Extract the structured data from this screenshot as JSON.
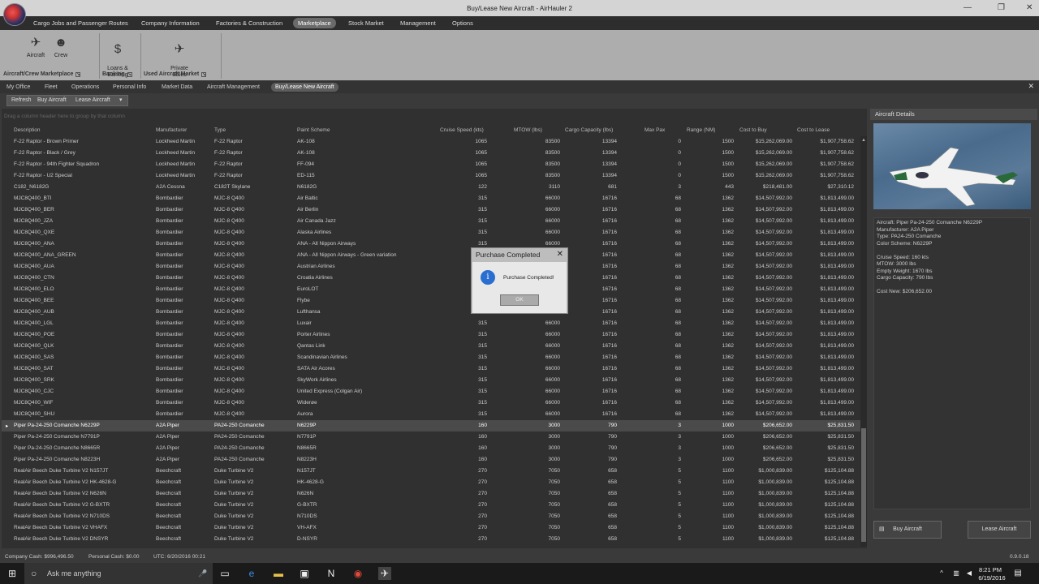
{
  "window": {
    "title": "Buy/Lease New Aircraft - AirHauler 2"
  },
  "menu": {
    "items": [
      "Cargo Jobs and Passenger Routes",
      "Company Information",
      "Factories & Construction",
      "Marketplace",
      "Stock Market",
      "Management",
      "Options"
    ],
    "active": "Marketplace"
  },
  "ribbon": {
    "aircraft": "Aircraft",
    "crew": "Crew",
    "loans": "Loans &\nBanking",
    "private_sales": "Private\nSales",
    "group_aircraft_crew": "Aircraft/Crew Marketplace",
    "group_banking": "Banking",
    "group_used": "Used Aircraft Market"
  },
  "subtabs": {
    "items": [
      "My Office",
      "Fleet",
      "Operations",
      "Personal Info",
      "Market Data",
      "Aircraft Management",
      "Buy/Lease New Aircraft"
    ],
    "active": "Buy/Lease New Aircraft"
  },
  "toolbar": {
    "refresh": "Refresh",
    "buy": "Buy Aircraft",
    "lease": "Lease Aircraft"
  },
  "grid": {
    "group_hint": "Drag a column header here to group by that column",
    "columns": [
      "Description",
      "Manufacturer",
      "Type",
      "Paint Scheme",
      "Cruise Speed (kts)",
      "MTOW (lbs)",
      "Cargo Capacity (lbs)",
      "Max Pax",
      "Range (NM)",
      "Cost to Buy",
      "Cost to Lease"
    ],
    "rows": [
      [
        "F-22 Raptor - Brown Primer",
        "Lockheed Martin",
        "F-22 Raptor",
        "AK-108",
        "1065",
        "83500",
        "13394",
        "0",
        "1500",
        "$15,262,069.00",
        "$1,907,758.62"
      ],
      [
        "F-22 Raptor - Black / Grey",
        "Lockheed Martin",
        "F-22 Raptor",
        "AK-108",
        "1065",
        "83500",
        "13394",
        "0",
        "1500",
        "$15,262,069.00",
        "$1,907,758.62"
      ],
      [
        "F-22 Raptor - 94th Fighter Squadron",
        "Lockheed Martin",
        "F-22 Raptor",
        "FF-094",
        "1065",
        "83500",
        "13394",
        "0",
        "1500",
        "$15,262,069.00",
        "$1,907,758.62"
      ],
      [
        "F-22 Raptor - U2 Special",
        "Lockheed Martin",
        "F-22 Raptor",
        "ED-115",
        "1065",
        "83500",
        "13394",
        "0",
        "1500",
        "$15,262,069.00",
        "$1,907,758.62"
      ],
      [
        "C182_N6182G",
        "A2A Cessna",
        "C182T Skylane",
        "N6182G",
        "122",
        "3110",
        "681",
        "3",
        "443",
        "$218,481.00",
        "$27,310.12"
      ],
      [
        "MJC8Q400_BTI",
        "Bombardier",
        "MJC-8 Q400",
        "Air Baltic",
        "315",
        "66000",
        "16716",
        "68",
        "1362",
        "$14,507,992.00",
        "$1,813,499.00"
      ],
      [
        "MJC8Q400_BER",
        "Bombardier",
        "MJC-8 Q400",
        "Air Berlin",
        "315",
        "66000",
        "16716",
        "68",
        "1362",
        "$14,507,992.00",
        "$1,813,499.00"
      ],
      [
        "MJC8Q400_JZA",
        "Bombardier",
        "MJC-8 Q400",
        "Air Canada Jazz",
        "315",
        "66000",
        "16716",
        "68",
        "1362",
        "$14,507,992.00",
        "$1,813,499.00"
      ],
      [
        "MJC8Q400_QXE",
        "Bombardier",
        "MJC-8 Q400",
        "Alaska Airlines",
        "315",
        "66000",
        "16716",
        "68",
        "1362",
        "$14,507,992.00",
        "$1,813,499.00"
      ],
      [
        "MJC8Q400_ANA",
        "Bombardier",
        "MJC-8 Q400",
        "ANA - All Nippon Airways",
        "315",
        "66000",
        "16716",
        "68",
        "1362",
        "$14,507,992.00",
        "$1,813,499.00"
      ],
      [
        "MJC8Q400_ANA_GREEN",
        "Bombardier",
        "MJC-8 Q400",
        "ANA - All Nippon Airways - Green variation",
        "315",
        "66000",
        "16716",
        "68",
        "1362",
        "$14,507,992.00",
        "$1,813,499.00"
      ],
      [
        "MJC8Q400_AUA",
        "Bombardier",
        "MJC-8 Q400",
        "Austrian Airlines",
        "315",
        "66000",
        "16716",
        "68",
        "1362",
        "$14,507,992.00",
        "$1,813,499.00"
      ],
      [
        "MJC8Q400_CTN",
        "Bombardier",
        "MJC-8 Q400",
        "Croatia Airlines",
        "315",
        "66000",
        "16716",
        "68",
        "1362",
        "$14,507,992.00",
        "$1,813,499.00"
      ],
      [
        "MJC8Q400_ELO",
        "Bombardier",
        "MJC-8 Q400",
        "EuroLOT",
        "315",
        "66000",
        "16716",
        "68",
        "1362",
        "$14,507,992.00",
        "$1,813,499.00"
      ],
      [
        "MJC8Q400_BEE",
        "Bombardier",
        "MJC-8 Q400",
        "Flybe",
        "315",
        "66000",
        "16716",
        "68",
        "1362",
        "$14,507,992.00",
        "$1,813,499.00"
      ],
      [
        "MJC8Q400_AUB",
        "Bombardier",
        "MJC-8 Q400",
        "Lufthansa",
        "315",
        "66000",
        "16716",
        "68",
        "1362",
        "$14,507,992.00",
        "$1,813,499.00"
      ],
      [
        "MJC8Q400_LGL",
        "Bombardier",
        "MJC-8 Q400",
        "Luxair",
        "315",
        "66000",
        "16716",
        "68",
        "1362",
        "$14,507,992.00",
        "$1,813,499.00"
      ],
      [
        "MJC8Q400_POE",
        "Bombardier",
        "MJC-8 Q400",
        "Porter Airlines",
        "315",
        "66000",
        "16716",
        "68",
        "1362",
        "$14,507,992.00",
        "$1,813,499.00"
      ],
      [
        "MJC8Q400_QLK",
        "Bombardier",
        "MJC-8 Q400",
        "Qantas Link",
        "315",
        "66000",
        "16716",
        "68",
        "1362",
        "$14,507,992.00",
        "$1,813,499.00"
      ],
      [
        "MJC8Q400_SAS",
        "Bombardier",
        "MJC-8 Q400",
        "Scandinavian Airlines",
        "315",
        "66000",
        "16716",
        "68",
        "1362",
        "$14,507,992.00",
        "$1,813,499.00"
      ],
      [
        "MJC8Q400_SAT",
        "Bombardier",
        "MJC-8 Q400",
        "SATA Air Acores",
        "315",
        "66000",
        "16716",
        "68",
        "1362",
        "$14,507,992.00",
        "$1,813,499.00"
      ],
      [
        "MJC8Q400_SRK",
        "Bombardier",
        "MJC-8 Q400",
        "SkyWork Airlines",
        "315",
        "66000",
        "16716",
        "68",
        "1362",
        "$14,507,992.00",
        "$1,813,499.00"
      ],
      [
        "MJC8Q400_CJC",
        "Bombardier",
        "MJC-8 Q400",
        "United Express (Colgan Air)",
        "315",
        "66000",
        "16716",
        "68",
        "1362",
        "$14,507,992.00",
        "$1,813,499.00"
      ],
      [
        "MJC8Q400_WIF",
        "Bombardier",
        "MJC-8 Q400",
        "Widerøe",
        "315",
        "66000",
        "16716",
        "68",
        "1362",
        "$14,507,992.00",
        "$1,813,499.00"
      ],
      [
        "MJC8Q400_SHU",
        "Bombardier",
        "MJC-8 Q400",
        "Aurora",
        "315",
        "66000",
        "16716",
        "68",
        "1362",
        "$14,507,992.00",
        "$1,813,499.00"
      ],
      [
        "Piper Pa-24-250 Comanche N6229P",
        "A2A Piper",
        "PA24-250 Comanche",
        "N6229P",
        "160",
        "3000",
        "790",
        "3",
        "1000",
        "$206,652.00",
        "$25,831.50"
      ],
      [
        "Piper Pa-24-250 Comanche N7791P",
        "A2A Piper",
        "PA24-250 Comanche",
        "N7791P",
        "160",
        "3000",
        "790",
        "3",
        "1000",
        "$206,652.00",
        "$25,831.50"
      ],
      [
        "Piper Pa-24-250 Comanche N8665R",
        "A2A Piper",
        "PA24-250 Comanche",
        "N8665R",
        "160",
        "3000",
        "790",
        "3",
        "1000",
        "$206,652.00",
        "$25,831.50"
      ],
      [
        "Piper Pa-24-250 Comanche N8223H",
        "A2A Piper",
        "PA24-250 Comanche",
        "N8223H",
        "160",
        "3000",
        "790",
        "3",
        "1000",
        "$206,652.00",
        "$25,831.50"
      ],
      [
        "RealAir Beech Duke Turbine V2 N157JT",
        "Beechcraft",
        "Duke Turbine V2",
        "N157JT",
        "270",
        "7050",
        "658",
        "5",
        "1100",
        "$1,000,839.00",
        "$125,104.88"
      ],
      [
        "RealAir Beech Duke Turbine V2 HK-4628-G",
        "Beechcraft",
        "Duke Turbine V2",
        "HK-4628-G",
        "270",
        "7050",
        "658",
        "5",
        "1100",
        "$1,000,839.00",
        "$125,104.88"
      ],
      [
        "RealAir Beech Duke Turbine V2 N626N",
        "Beechcraft",
        "Duke Turbine V2",
        "N626N",
        "270",
        "7050",
        "658",
        "5",
        "1100",
        "$1,000,839.00",
        "$125,104.88"
      ],
      [
        "RealAir Beech Duke Turbine V2 G-BXTR",
        "Beechcraft",
        "Duke Turbine V2",
        "G-BXTR",
        "270",
        "7050",
        "658",
        "5",
        "1100",
        "$1,000,839.00",
        "$125,104.88"
      ],
      [
        "RealAir Beech Duke Turbine V2 N710DS",
        "Beechcraft",
        "Duke Turbine V2",
        "N710DS",
        "270",
        "7050",
        "658",
        "5",
        "1100",
        "$1,000,839.00",
        "$125,104.88"
      ],
      [
        "RealAir Beech Duke Turbine V2 VHAFX",
        "Beechcraft",
        "Duke Turbine V2",
        "VH-AFX",
        "270",
        "7050",
        "658",
        "5",
        "1100",
        "$1,000,839.00",
        "$125,104.88"
      ],
      [
        "RealAir Beech Duke Turbine V2 DNSYR",
        "Beechcraft",
        "Duke Turbine V2",
        "D-NSYR",
        "270",
        "7050",
        "658",
        "5",
        "1100",
        "$1,000,839.00",
        "$125,104.88"
      ]
    ],
    "selected_index": 25
  },
  "details": {
    "header": "Aircraft Details",
    "lines": [
      "Aircraft: Piper Pa-24-250 Comanche N6229P",
      "Manufacturer: A2A Piper",
      "Type: PA24-250 Comanche",
      "Color Scheme: N6229P",
      "",
      "Cruise Speed: 160 kts",
      "MTOW: 3000 lbs",
      "Empty Weight: 1670 lbs",
      "Cargo Capacity: 790 lbs",
      "",
      "Cost New: $206,652.00"
    ],
    "buy_button": "Buy Aircraft",
    "lease_button": "Lease Aircraft"
  },
  "dialog": {
    "title": "Purchase Completed",
    "message": "Purchase Completed!",
    "ok": "OK"
  },
  "status": {
    "company_cash": "Company Cash: $996,496.50",
    "personal_cash": "Personal Cash: $0.00",
    "utc": "UTC: 6/20/2016 00:21",
    "version": "0.9.0.18"
  },
  "taskbar": {
    "search_placeholder": "Ask me anything",
    "time": "8:21 PM",
    "date": "6/19/2016"
  }
}
